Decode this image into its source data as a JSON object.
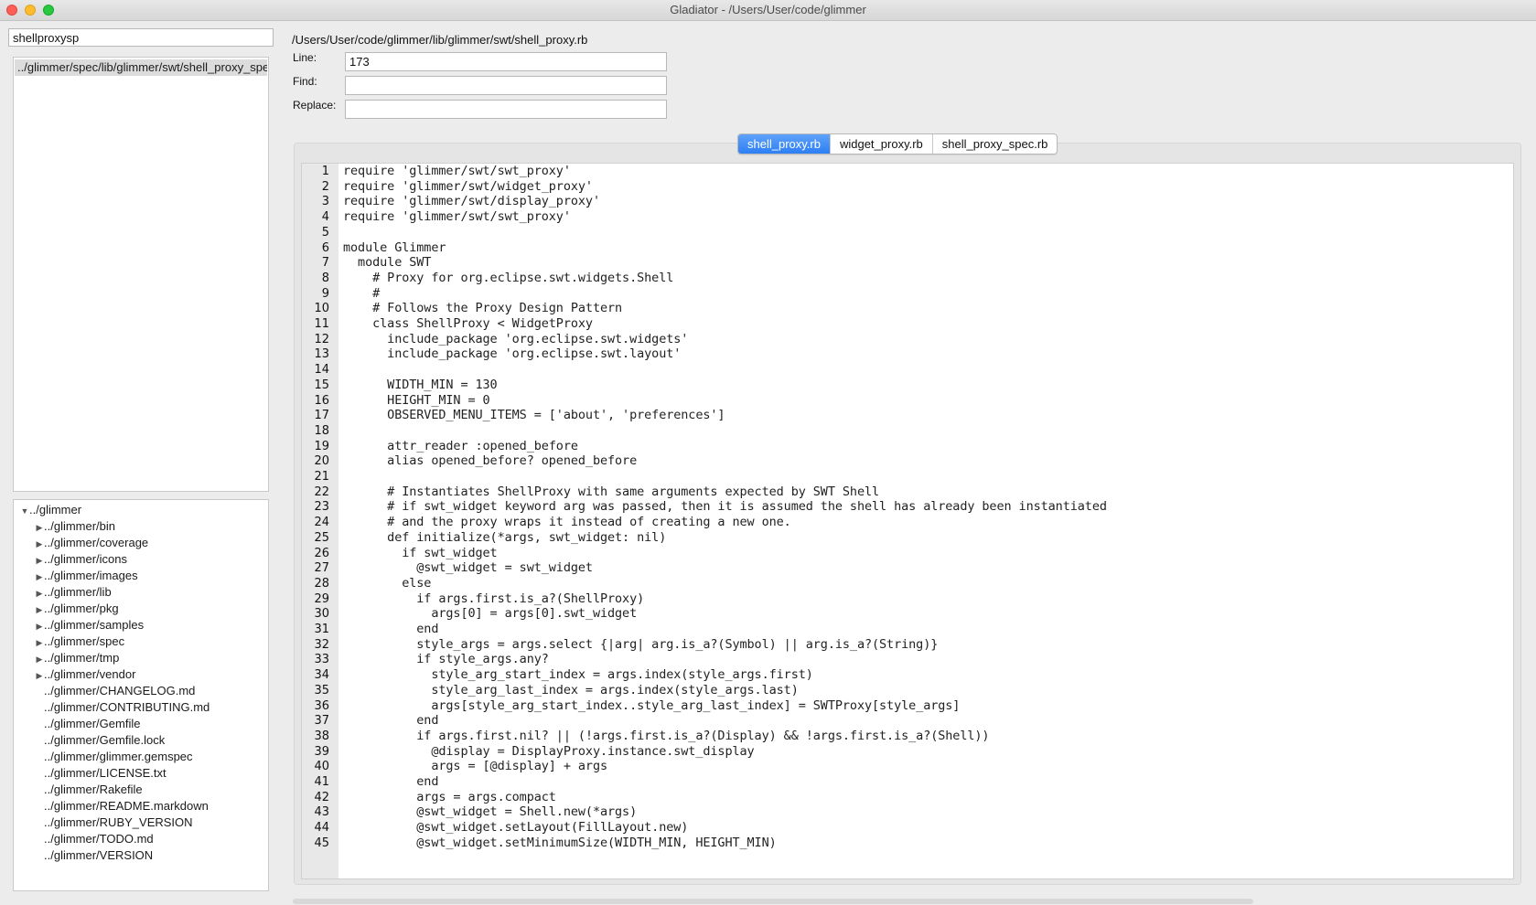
{
  "window": {
    "title": "Gladiator - /Users/User/code/glimmer"
  },
  "left_panel": {
    "search_value": "shellproxysp",
    "results": [
      "../glimmer/spec/lib/glimmer/swt/shell_proxy_spec.rb"
    ],
    "tree": {
      "root": "../glimmer",
      "folders": [
        "../glimmer/bin",
        "../glimmer/coverage",
        "../glimmer/icons",
        "../glimmer/images",
        "../glimmer/lib",
        "../glimmer/pkg",
        "../glimmer/samples",
        "../glimmer/spec",
        "../glimmer/tmp",
        "../glimmer/vendor"
      ],
      "files": [
        "../glimmer/CHANGELOG.md",
        "../glimmer/CONTRIBUTING.md",
        "../glimmer/Gemfile",
        "../glimmer/Gemfile.lock",
        "../glimmer/glimmer.gemspec",
        "../glimmer/LICENSE.txt",
        "../glimmer/Rakefile",
        "../glimmer/README.markdown",
        "../glimmer/RUBY_VERSION",
        "../glimmer/TODO.md",
        "../glimmer/VERSION"
      ]
    }
  },
  "editor_header": {
    "file_path": "/Users/User/code/glimmer/lib/glimmer/swt/shell_proxy.rb",
    "line_label": "Line:",
    "line_value": "173",
    "find_label": "Find:",
    "find_value": "",
    "replace_label": "Replace:",
    "replace_value": ""
  },
  "tabs": [
    {
      "label": "shell_proxy.rb",
      "active": true
    },
    {
      "label": "widget_proxy.rb",
      "active": false
    },
    {
      "label": "shell_proxy_spec.rb",
      "active": false
    }
  ],
  "code_lines": [
    "require 'glimmer/swt/swt_proxy'",
    "require 'glimmer/swt/widget_proxy'",
    "require 'glimmer/swt/display_proxy'",
    "require 'glimmer/swt/swt_proxy'",
    "",
    "module Glimmer",
    "  module SWT",
    "    # Proxy for org.eclipse.swt.widgets.Shell",
    "    #",
    "    # Follows the Proxy Design Pattern",
    "    class ShellProxy < WidgetProxy",
    "      include_package 'org.eclipse.swt.widgets'",
    "      include_package 'org.eclipse.swt.layout'",
    "",
    "      WIDTH_MIN = 130",
    "      HEIGHT_MIN = 0",
    "      OBSERVED_MENU_ITEMS = ['about', 'preferences']",
    "",
    "      attr_reader :opened_before",
    "      alias opened_before? opened_before",
    "",
    "      # Instantiates ShellProxy with same arguments expected by SWT Shell",
    "      # if swt_widget keyword arg was passed, then it is assumed the shell has already been instantiated",
    "      # and the proxy wraps it instead of creating a new one.",
    "      def initialize(*args, swt_widget: nil)",
    "        if swt_widget",
    "          @swt_widget = swt_widget",
    "        else",
    "          if args.first.is_a?(ShellProxy)",
    "            args[0] = args[0].swt_widget",
    "          end",
    "          style_args = args.select {|arg| arg.is_a?(Symbol) || arg.is_a?(String)}",
    "          if style_args.any?",
    "            style_arg_start_index = args.index(style_args.first)",
    "            style_arg_last_index = args.index(style_args.last)",
    "            args[style_arg_start_index..style_arg_last_index] = SWTProxy[style_args]",
    "          end",
    "          if args.first.nil? || (!args.first.is_a?(Display) && !args.first.is_a?(Shell))",
    "            @display = DisplayProxy.instance.swt_display",
    "            args = [@display] + args",
    "          end",
    "          args = args.compact",
    "          @swt_widget = Shell.new(*args)",
    "          @swt_widget.setLayout(FillLayout.new)",
    "          @swt_widget.setMinimumSize(WIDTH_MIN, HEIGHT_MIN)"
  ]
}
